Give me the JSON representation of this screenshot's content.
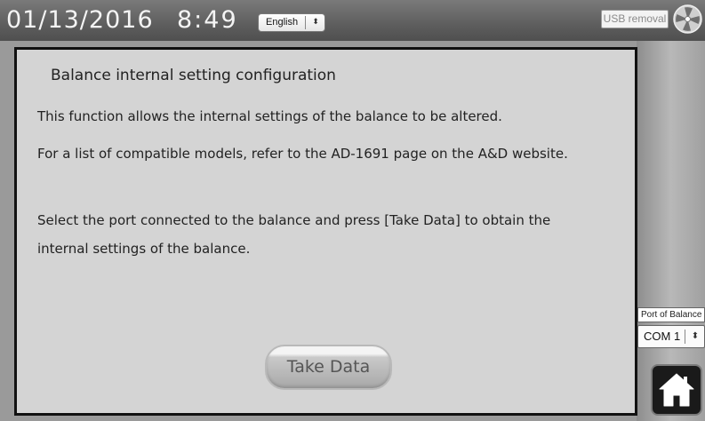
{
  "header": {
    "date": "01/13/2016",
    "time": "8:49",
    "language_select": {
      "selected": "English",
      "arrows": "⬍"
    },
    "usb_button_label": "USB removal",
    "usb_icon": "usb-fan-icon"
  },
  "panel": {
    "title": "Balance internal setting configuration",
    "paragraphs": [
      "This function allows the internal settings of the balance to be altered.",
      "For a list of compatible models, refer to the AD-1691 page on the A&D website.",
      "Select the port connected to the balance and press [Take Data] to obtain the",
      "internal settings of the balance."
    ],
    "take_data_label": "Take Data"
  },
  "port": {
    "label": "Port of Balance",
    "selected": "COM 1",
    "arrows": "⬍"
  },
  "home_button": {
    "icon": "home-icon"
  },
  "colors": {
    "panel_background": "#d4d4d4",
    "panel_border": "#111111",
    "topbar": "#5e5e5e",
    "header_text": "#f4f4f4"
  }
}
